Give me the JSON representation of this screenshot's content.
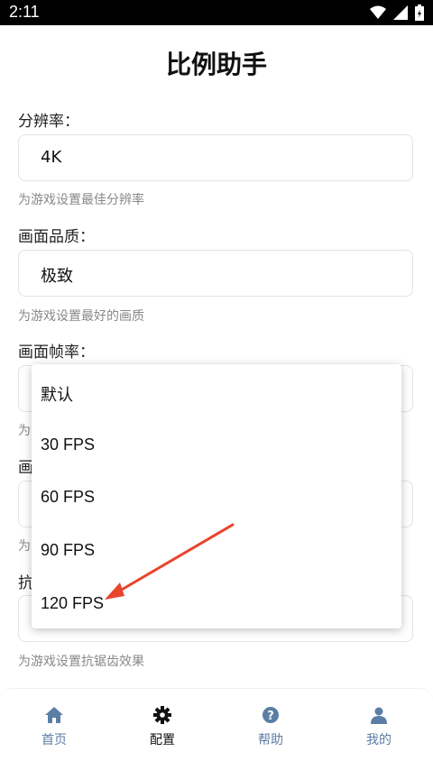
{
  "status_bar": {
    "time": "2:11"
  },
  "page_title": "比例助手",
  "settings": [
    {
      "label": "分辨率：",
      "value": "4K",
      "hint": "为游戏设置最佳分辨率"
    },
    {
      "label": "画面品质：",
      "value": "极致",
      "hint": "为游戏设置最好的画质"
    },
    {
      "label": "画面帧率：",
      "value": "",
      "hint": "为"
    },
    {
      "label": "画",
      "value": "",
      "hint": "为"
    },
    {
      "label": "抗",
      "value": "",
      "hint": "为游戏设置抗锯齿效果"
    }
  ],
  "dropdown": {
    "options": [
      "默认",
      "30 FPS",
      "60 FPS",
      "90 FPS",
      "120 FPS"
    ],
    "highlight_option": "120 FPS"
  },
  "bottom_nav": [
    {
      "label": "首页",
      "icon": "home-icon",
      "active": false
    },
    {
      "label": "配置",
      "icon": "gear-icon",
      "active": true
    },
    {
      "label": "帮助",
      "icon": "help-icon",
      "active": false
    },
    {
      "label": "我的",
      "icon": "user-icon",
      "active": false
    }
  ],
  "colors": {
    "accent_inactive": "#5b7ea6",
    "arrow": "#e8452c"
  }
}
